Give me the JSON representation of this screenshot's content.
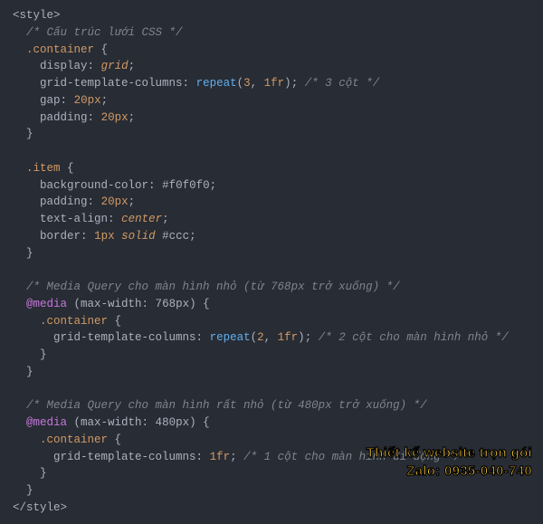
{
  "code": {
    "openTag": "<style>",
    "closeTag": "</style>",
    "c1": "/* Cấu trúc lưới CSS */",
    "sel_container": ".container",
    "sel_item": ".item",
    "prop_display": "display",
    "prop_gtc": "grid-template-columns",
    "prop_gap": "gap",
    "prop_padding": "padding",
    "prop_bgcolor": "background-color",
    "prop_textalign": "text-align",
    "prop_border": "border",
    "val_grid": "grid",
    "func_repeat": "repeat",
    "val_3": "3",
    "val_2": "2",
    "val_1fr": "1fr",
    "c_3col": "/* 3 cột */",
    "val_20px": "20px",
    "val_f0f0f0": "#f0f0f0",
    "val_center": "center",
    "val_1px": "1px",
    "val_solid": "solid",
    "val_ccc": "#ccc",
    "c2": "/* Media Query cho màn hình nhỏ (từ 768px trở xuống) */",
    "kw_media": "@media",
    "cond_768": "(max-width: 768px)",
    "c_2col": "/* 2 cột cho màn hình nhỏ */",
    "c3": "/* Media Query cho màn hình rất nhỏ (từ 480px trở xuống) */",
    "cond_480": "(max-width: 480px)",
    "c_1col": "/* 1 cột cho màn hình di động */"
  },
  "overlay": {
    "line1": "Thiết kế website trọn gói",
    "line2": "Zalo: 0935-040-740"
  }
}
